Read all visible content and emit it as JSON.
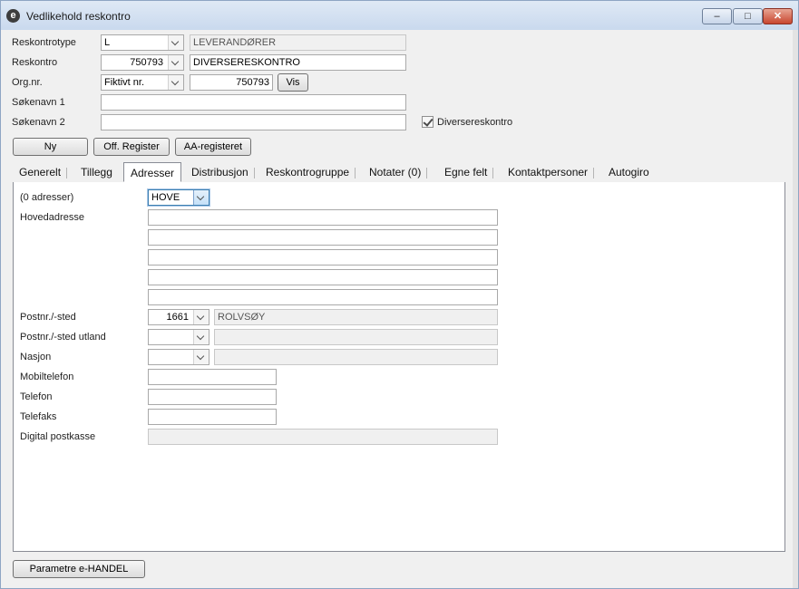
{
  "window": {
    "title": "Vedlikehold reskontro",
    "min_label": "‒",
    "max_label": "□",
    "close_label": "✕"
  },
  "header": {
    "reskontrotype": {
      "label": "Reskontrotype",
      "value": "L",
      "description": "LEVERANDØRER"
    },
    "reskontro": {
      "label": "Reskontro",
      "value": "750793",
      "name": "DIVERSERESKONTRO"
    },
    "orgnr": {
      "label": "Org.nr.",
      "type": "Fiktivt nr.",
      "value": "750793",
      "vis_button": "Vis"
    },
    "sokenavn1": {
      "label": "Søkenavn 1",
      "value": ""
    },
    "sokenavn2": {
      "label": "Søkenavn 2",
      "value": ""
    },
    "diversereskontro": {
      "label": "Diversereskontro",
      "checked": true
    },
    "buttons": {
      "ny": "Ny",
      "off_register": "Off. Register",
      "aa_register": "AA-registeret"
    }
  },
  "tabs": [
    {
      "label": "Generelt"
    },
    {
      "label": "Tillegg"
    },
    {
      "label": "Adresser",
      "active": true
    },
    {
      "label": "Distribusjon"
    },
    {
      "label": "Reskontrogruppe"
    },
    {
      "label": "Notater (0)"
    },
    {
      "label": "Egne felt"
    },
    {
      "label": "Kontaktpersoner"
    },
    {
      "label": "Autogiro"
    }
  ],
  "address": {
    "count_label": "(0 adresser)",
    "type_value": "HOVE",
    "hovedadresse_label": "Hovedadresse",
    "lines": [
      "",
      "",
      "",
      "",
      ""
    ],
    "postnr": {
      "label": "Postnr./-sted",
      "value": "1661",
      "place": "ROLVSØY"
    },
    "postnr_utland": {
      "label": "Postnr./-sted utland",
      "value": "",
      "place": ""
    },
    "nasjon": {
      "label": "Nasjon",
      "value": "",
      "name": ""
    },
    "mobiltelefon": {
      "label": "Mobiltelefon",
      "value": ""
    },
    "telefon": {
      "label": "Telefon",
      "value": ""
    },
    "telefaks": {
      "label": "Telefaks",
      "value": ""
    },
    "digital_postkasse": {
      "label": "Digital postkasse",
      "value": ""
    }
  },
  "footer": {
    "parametre_button": "Parametre e-HANDEL"
  }
}
